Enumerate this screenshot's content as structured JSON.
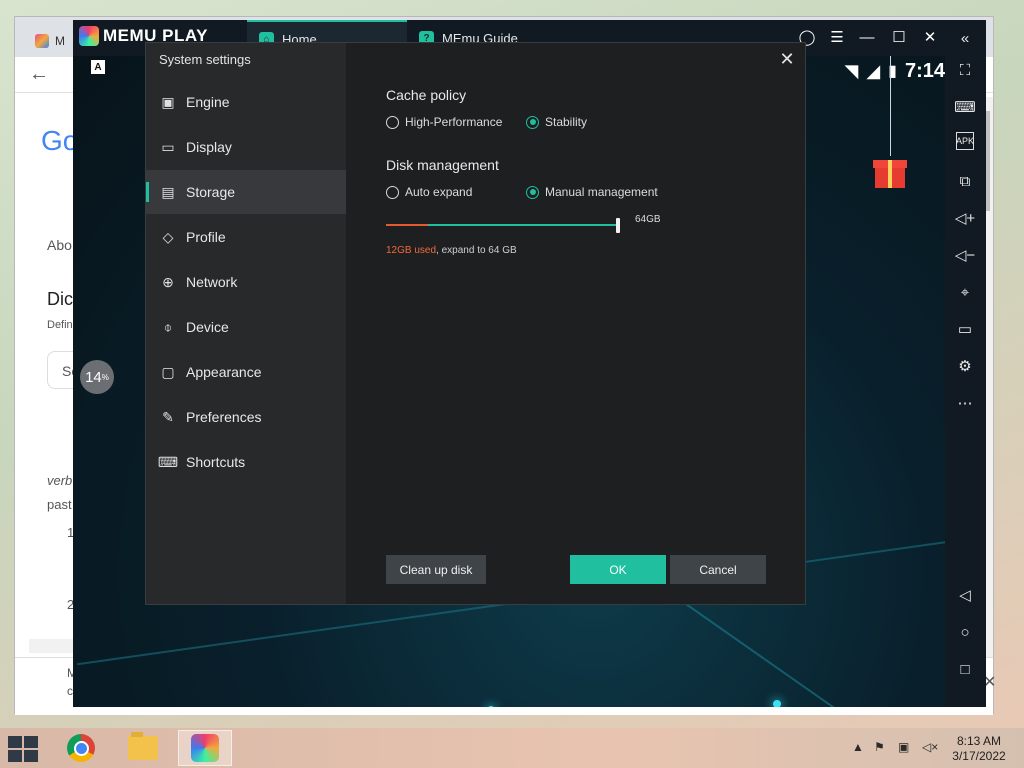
{
  "browser": {
    "tab_label": "M",
    "google_logo": "Go",
    "snippets": {
      "about": "Abo",
      "title": "Dic",
      "def": "Defin",
      "search": "Se",
      "verb": "verb",
      "past": "past",
      "n1": "1",
      "n2": "2",
      "bottom": "M",
      "bottom2": "c"
    }
  },
  "progress": {
    "value": "14",
    "unit": "%"
  },
  "memu": {
    "logo_text": "MEMU PLAY",
    "tabs": [
      {
        "label": "Home",
        "icon": "home-icon"
      },
      {
        "label": "MEmu Guide",
        "icon": "guide-icon"
      }
    ],
    "status_time": "7:14",
    "a_badge": "A"
  },
  "dialog": {
    "title": "System settings",
    "nav": [
      {
        "label": "Engine",
        "icon": "chip-icon"
      },
      {
        "label": "Display",
        "icon": "monitor-icon"
      },
      {
        "label": "Storage",
        "icon": "storage-icon"
      },
      {
        "label": "Profile",
        "icon": "tag-icon"
      },
      {
        "label": "Network",
        "icon": "globe-icon"
      },
      {
        "label": "Device",
        "icon": "microphone-icon"
      },
      {
        "label": "Appearance",
        "icon": "window-icon"
      },
      {
        "label": "Preferences",
        "icon": "wrench-icon"
      },
      {
        "label": "Shortcuts",
        "icon": "keyboard-icon"
      }
    ],
    "active_nav": "Storage",
    "cache_policy": {
      "title": "Cache policy",
      "options": [
        "High-Performance",
        "Stability"
      ],
      "selected": "Stability"
    },
    "disk_management": {
      "title": "Disk management",
      "options": [
        "Auto expand",
        "Manual management"
      ],
      "selected": "Manual management",
      "slider_value": "64GB",
      "used_text": "12GB used",
      "expand_text": ", expand to 64 GB"
    },
    "buttons": {
      "cleanup": "Clean up disk",
      "ok": "OK",
      "cancel": "Cancel"
    }
  },
  "taskbar": {
    "apps": [
      "Chrome",
      "File Explorer",
      "MEmu"
    ],
    "time": "8:13 AM",
    "date": "3/17/2022"
  }
}
